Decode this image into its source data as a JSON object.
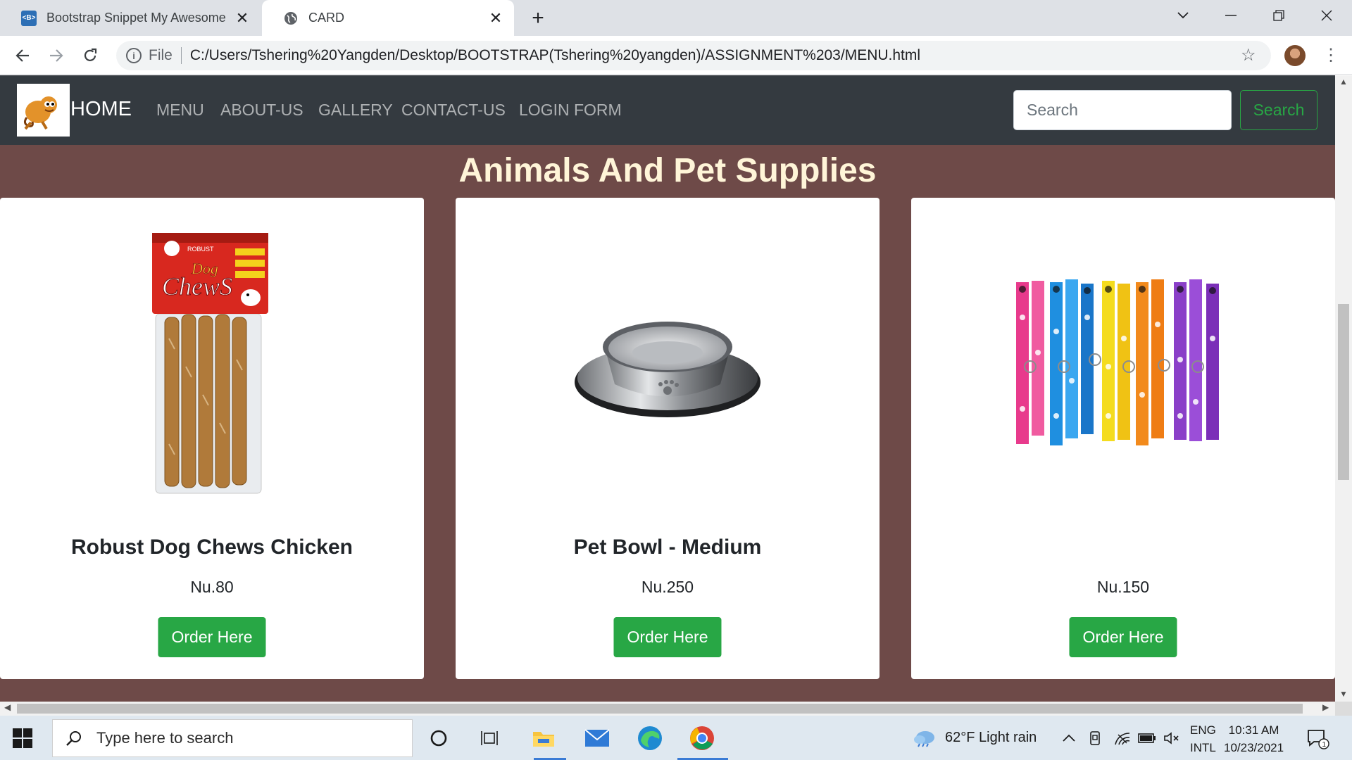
{
  "browser": {
    "tabs": [
      {
        "title": "Bootstrap Snippet My Awesome",
        "favicon": "bootstrap-icon",
        "active": false
      },
      {
        "title": "CARD",
        "favicon": "globe-icon",
        "active": true
      }
    ],
    "address": {
      "scheme_label": "File",
      "url": "C:/Users/Tshering%20Yangden/Desktop/BOOTSTRAP(Tshering%20yangden)/ASSIGNMENT%203/MENU.html"
    }
  },
  "page": {
    "navbar": {
      "brand": "HOME",
      "links": [
        "MENU",
        "ABOUT-US",
        "GALLERY",
        "CONTACT-US",
        "LOGIN FORM"
      ],
      "search_placeholder": "Search",
      "search_button": "Search"
    },
    "section_title": "Animals And Pet Supplies",
    "cards": [
      {
        "title": "Robust Dog Chews Chicken",
        "price": "Nu.80",
        "button": "Order Here",
        "image": "dog-chews-package",
        "pack_brand": "ROBUST",
        "pack_title_1": "Dog",
        "pack_title_2": "ChewS"
      },
      {
        "title": "Pet Bowl - Medium",
        "price": "Nu.250",
        "button": "Order Here",
        "image": "steel-pet-bowl"
      },
      {
        "title": "",
        "price": "Nu.150",
        "button": "Order Here",
        "image": "colorful-pet-collars"
      }
    ],
    "colors": {
      "page_bg": "#6e4a48",
      "navbar_bg": "#343a40",
      "title_color": "#fff5d8",
      "success": "#28a745"
    }
  },
  "taskbar": {
    "search_placeholder": "Type here to search",
    "weather": "62°F  Light rain",
    "language_top": "ENG",
    "language_bottom": "INTL",
    "time": "10:31 AM",
    "date": "10/23/2021",
    "notification_count": "1"
  }
}
